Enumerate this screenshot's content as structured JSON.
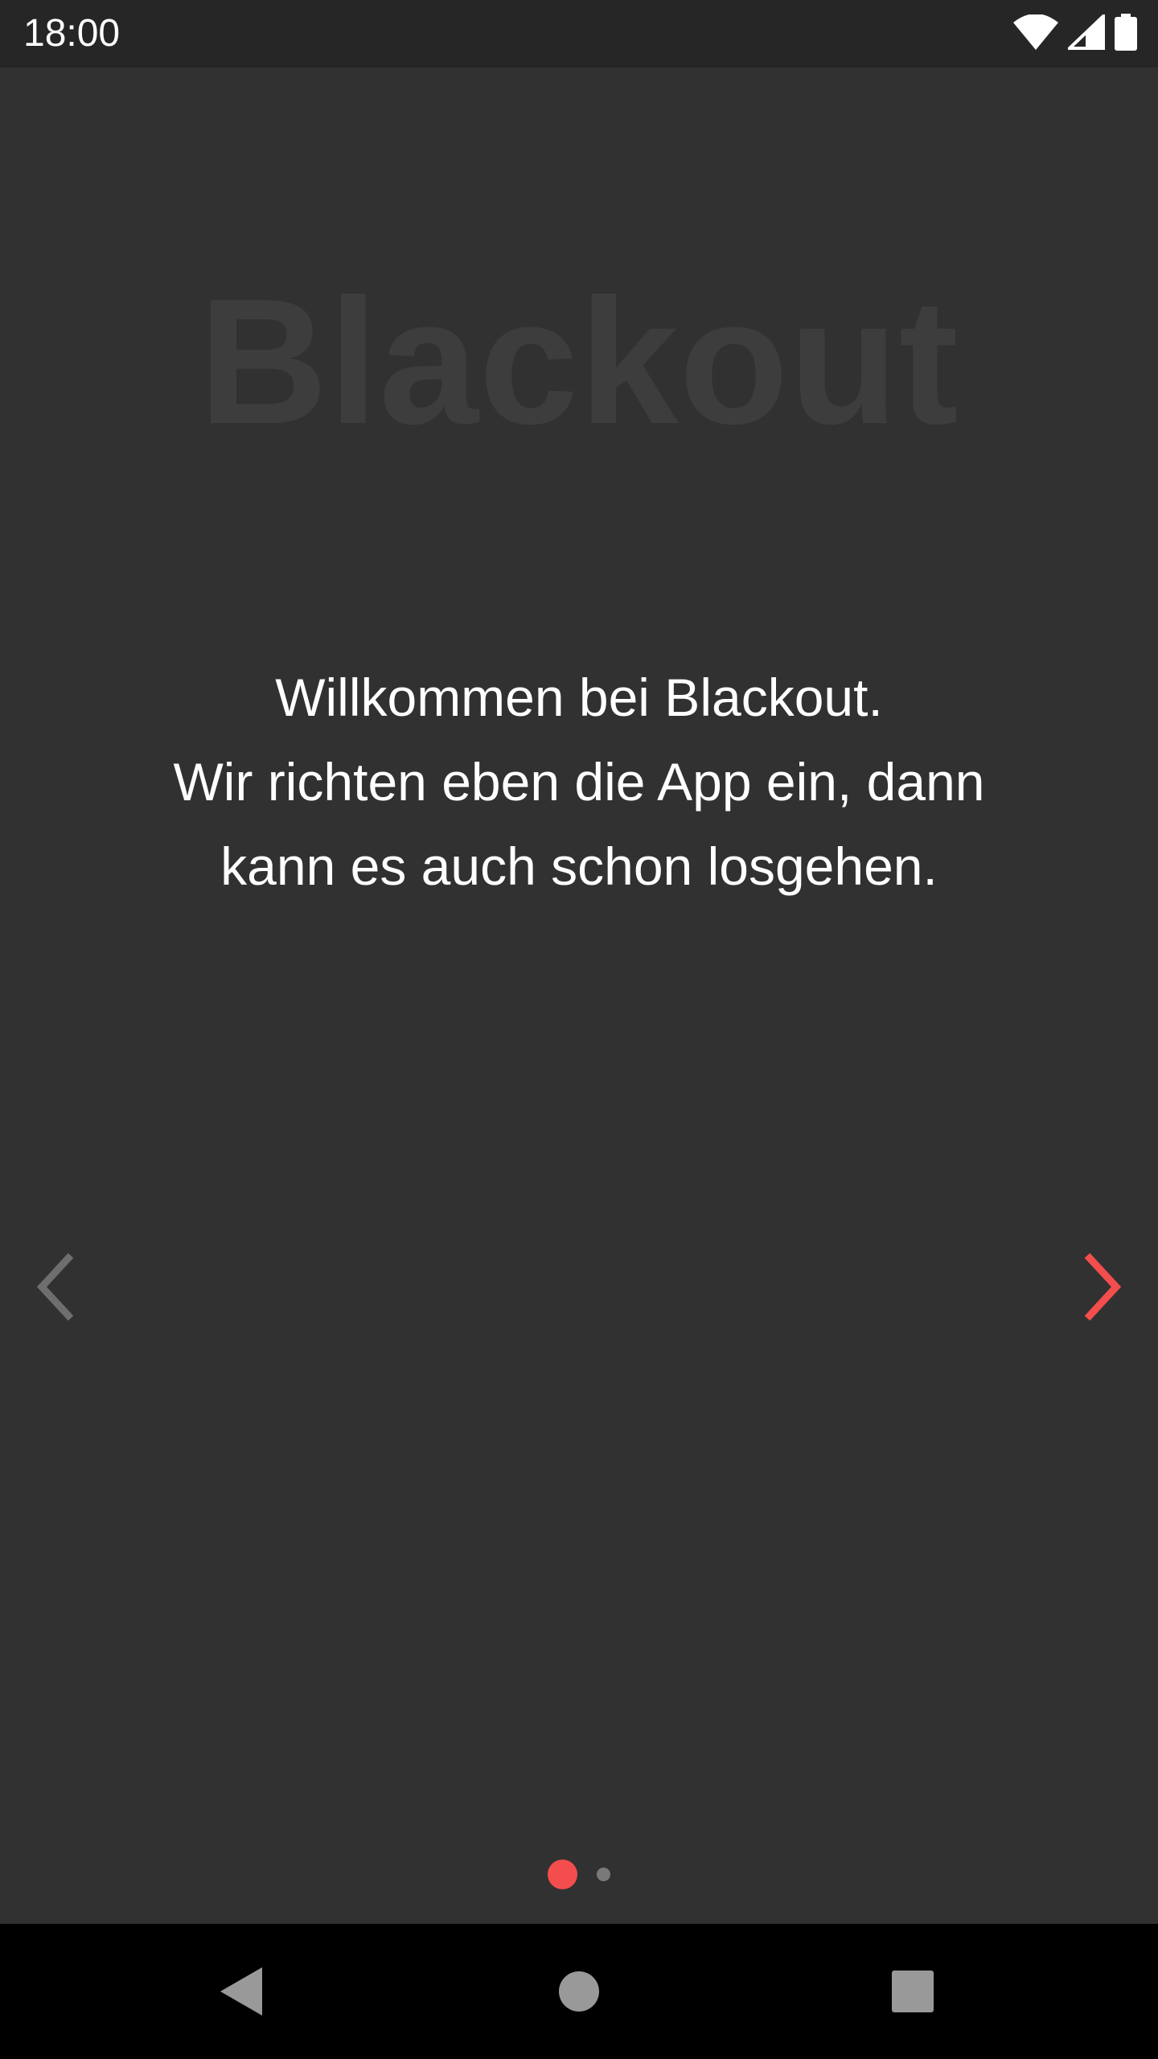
{
  "status_bar": {
    "time": "18:00",
    "icons": [
      "wifi-icon",
      "cellular-signal-icon",
      "battery-icon"
    ]
  },
  "onboarding": {
    "app_title": "Blackout",
    "welcome_lines": [
      "Willkommen bei Blackout.",
      "Wir richten eben die App ein, dann",
      "kann es auch schon losgehen."
    ],
    "prev_icon": "chevron-left-icon",
    "next_icon": "chevron-right-icon",
    "page_indicator": {
      "total_pages": 2,
      "current_page": 1
    }
  },
  "system_nav": {
    "buttons": [
      "back-icon",
      "home-icon",
      "recents-icon"
    ]
  },
  "colors": {
    "background": "#323132",
    "status_bar": "#272627",
    "accent": "#f44d4d",
    "title_watermark": "#3e3d3e",
    "disabled_arrow": "#6f6e6f",
    "nav_bar": "#000000"
  }
}
